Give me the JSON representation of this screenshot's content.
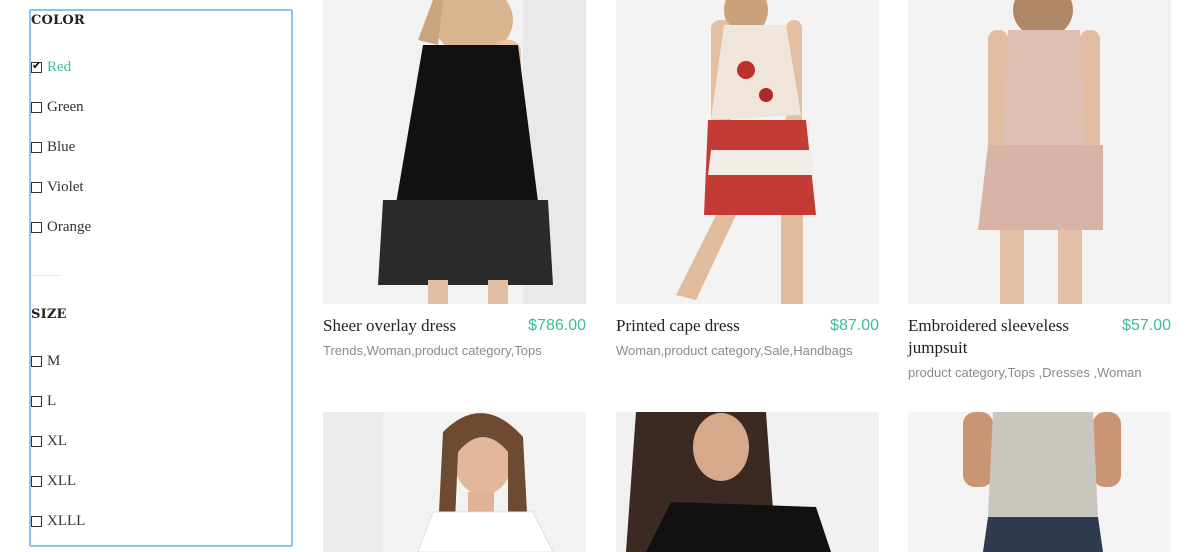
{
  "filters": {
    "color": {
      "title": "COLOR",
      "options": [
        {
          "label": "Red",
          "checked": true
        },
        {
          "label": "Green",
          "checked": false
        },
        {
          "label": "Blue",
          "checked": false
        },
        {
          "label": "Violet",
          "checked": false
        },
        {
          "label": "Orange",
          "checked": false
        }
      ]
    },
    "size": {
      "title": "SIZE",
      "options": [
        {
          "label": "M",
          "checked": false
        },
        {
          "label": "L",
          "checked": false
        },
        {
          "label": "XL",
          "checked": false
        },
        {
          "label": "XLL",
          "checked": false
        },
        {
          "label": "XLLL",
          "checked": false
        }
      ]
    }
  },
  "products": [
    {
      "name": "Sheer overlay dress",
      "price": "$786.00",
      "categories": "Trends,Woman,product category,Tops"
    },
    {
      "name": "Printed cape dress",
      "price": "$87.00",
      "categories": "Woman,product category,Sale,Handbags"
    },
    {
      "name": "Embroidered sleeveless jumpsuit",
      "price": "$57.00",
      "categories": "product category,Tops ,Dresses ,Woman"
    },
    {
      "name": "",
      "price": "",
      "categories": ""
    },
    {
      "name": "",
      "price": "",
      "categories": ""
    },
    {
      "name": "",
      "price": "",
      "categories": ""
    }
  ],
  "colors": {
    "accent": "#3cbd97",
    "focus_border": "#8fc1f2",
    "muted": "#8a8a8a"
  }
}
